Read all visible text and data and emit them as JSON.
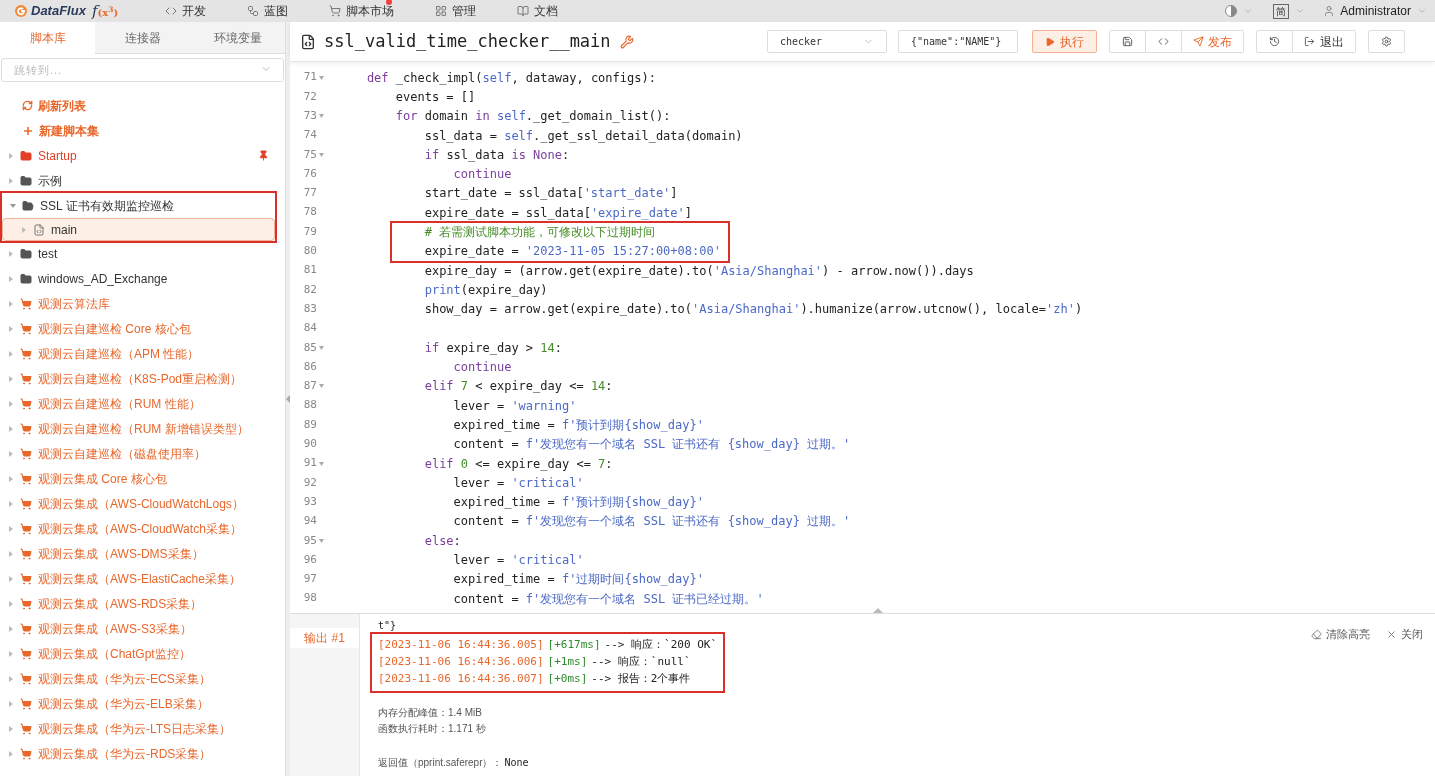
{
  "top_nav": {
    "logo": {
      "name": "DataFlux",
      "mark": "f",
      "mark_sub": "(x$^{3}$)"
    },
    "items": [
      {
        "label": "开发",
        "badge": false
      },
      {
        "label": "蓝图",
        "badge": false
      },
      {
        "label": "脚本市场",
        "badge": true
      },
      {
        "label": "管理",
        "badge": false
      },
      {
        "label": "文档",
        "badge": false
      }
    ],
    "language": "简",
    "user": "Administrator"
  },
  "sidebar": {
    "tabs": [
      {
        "label": "脚本库",
        "selected": true
      },
      {
        "label": "连接器",
        "selected": false
      },
      {
        "label": "环境变量",
        "selected": false
      }
    ],
    "search": {
      "placeholder": "跳转到..."
    },
    "actions": [
      {
        "label": "刷新列表",
        "kind": "refresh"
      },
      {
        "label": "新建脚本集",
        "kind": "add"
      }
    ],
    "tree": [
      {
        "label": "Startup",
        "kind": "pinned",
        "expanded": false,
        "marked": false
      },
      {
        "label": "示例",
        "kind": "folder",
        "expanded": false,
        "marked": false
      },
      {
        "label": "SSL 证书有效期监控巡检",
        "kind": "folder",
        "expanded": true,
        "marked": true,
        "children": [
          {
            "label": "main",
            "kind": "script",
            "selected": true
          }
        ]
      },
      {
        "label": "test",
        "kind": "folder",
        "expanded": false,
        "marked": false
      },
      {
        "label": "windows_AD_Exchange",
        "kind": "folder",
        "expanded": false,
        "marked": false
      },
      {
        "label": "观测云算法库",
        "kind": "market",
        "expanded": false,
        "marked": false
      },
      {
        "label": "观测云自建巡检 Core 核心包",
        "kind": "market",
        "expanded": false,
        "marked": false
      },
      {
        "label": "观测云自建巡检（APM 性能）",
        "kind": "market",
        "expanded": false,
        "marked": false
      },
      {
        "label": "观测云自建巡检（K8S-Pod重启检测）",
        "kind": "market",
        "expanded": false,
        "marked": false
      },
      {
        "label": "观测云自建巡检（RUM 性能）",
        "kind": "market",
        "expanded": false,
        "marked": false
      },
      {
        "label": "观测云自建巡检（RUM 新增错误类型）",
        "kind": "market",
        "expanded": false,
        "marked": false
      },
      {
        "label": "观测云自建巡检（磁盘使用率）",
        "kind": "market",
        "expanded": false,
        "marked": false
      },
      {
        "label": "观测云集成 Core 核心包",
        "kind": "market",
        "expanded": false,
        "marked": false
      },
      {
        "label": "观测云集成（AWS-CloudWatchLogs）",
        "kind": "market",
        "expanded": false,
        "marked": false
      },
      {
        "label": "观测云集成（AWS-CloudWatch采集）",
        "kind": "market",
        "expanded": false,
        "marked": false
      },
      {
        "label": "观测云集成（AWS-DMS采集）",
        "kind": "market",
        "expanded": false,
        "marked": false
      },
      {
        "label": "观测云集成（AWS-ElastiCache采集）",
        "kind": "market",
        "expanded": false,
        "marked": false
      },
      {
        "label": "观测云集成（AWS-RDS采集）",
        "kind": "market",
        "expanded": false,
        "marked": false
      },
      {
        "label": "观测云集成（AWS-S3采集）",
        "kind": "market",
        "expanded": false,
        "marked": false
      },
      {
        "label": "观测云集成（ChatGpt监控）",
        "kind": "market",
        "expanded": false,
        "marked": false
      },
      {
        "label": "观测云集成（华为云-ECS采集）",
        "kind": "market",
        "expanded": false,
        "marked": false
      },
      {
        "label": "观测云集成（华为云-ELB采集）",
        "kind": "market",
        "expanded": false,
        "marked": false
      },
      {
        "label": "观测云集成（华为云-LTS日志采集）",
        "kind": "market",
        "expanded": false,
        "marked": false
      },
      {
        "label": "观测云集成（华为云-RDS采集）",
        "kind": "market",
        "expanded": false,
        "marked": false
      }
    ]
  },
  "editor": {
    "title": "ssl_valid_time_checker__main",
    "func_select": "checker",
    "kwargs": "{\"name\":\"NAME\"}",
    "buttons": [
      {
        "label": "执行",
        "kind": "run"
      },
      {
        "kind": "save"
      },
      {
        "kind": "code"
      },
      {
        "label": "发布",
        "kind": "publish"
      },
      {
        "kind": "history"
      },
      {
        "label": "退出",
        "kind": "exit"
      },
      {
        "kind": "settings"
      }
    ],
    "lines": [
      {
        "n": "71",
        "fold": true,
        "marked": false,
        "tokens": [
          {
            "t": "    def",
            "color": "#7a3e9d"
          },
          {
            "t": " _check_impl("
          },
          {
            "t": "self",
            "color": "#4b69c6"
          },
          {
            "t": ", dataway, configs):"
          }
        ]
      },
      {
        "n": "72",
        "fold": false,
        "marked": false,
        "tokens": [
          {
            "t": "        events = []"
          }
        ]
      },
      {
        "n": "73",
        "fold": true,
        "marked": false,
        "tokens": [
          {
            "t": "        for",
            "color": "#7a3e9d"
          },
          {
            "t": " domain "
          },
          {
            "t": "in",
            "color": "#7a3e9d"
          },
          {
            "t": " self",
            "color": "#4b69c6"
          },
          {
            "t": "._get_domain_list():"
          }
        ]
      },
      {
        "n": "74",
        "fold": false,
        "marked": false,
        "tokens": [
          {
            "t": "            ssl_data = "
          },
          {
            "t": "self",
            "color": "#4b69c6"
          },
          {
            "t": "._get_ssl_detail_data(domain)"
          }
        ]
      },
      {
        "n": "75",
        "fold": true,
        "marked": false,
        "tokens": [
          {
            "t": "            if",
            "color": "#7a3e9d"
          },
          {
            "t": " ssl_data "
          },
          {
            "t": "is",
            "color": "#7a3e9d"
          },
          {
            "t": " None",
            "color": "#7a3e9d"
          },
          {
            "t": ":"
          }
        ]
      },
      {
        "n": "76",
        "fold": false,
        "marked": false,
        "tokens": [
          {
            "t": "                continue",
            "color": "#7a3e9d"
          }
        ]
      },
      {
        "n": "77",
        "fold": false,
        "marked": false,
        "tokens": [
          {
            "t": "            start_date = ssl_data["
          },
          {
            "t": "'start_date'",
            "color": "#4b69c6"
          },
          {
            "t": "]"
          }
        ]
      },
      {
        "n": "78",
        "fold": false,
        "marked": false,
        "tokens": [
          {
            "t": "            expire_date = ssl_data["
          },
          {
            "t": "'expire_date'",
            "color": "#4b69c6"
          },
          {
            "t": "]"
          }
        ]
      },
      {
        "n": "79",
        "fold": false,
        "marked": true,
        "tokens": [
          {
            "t": "            # 若需测试脚本功能，可修改以下过期时间",
            "color": "#448c27"
          }
        ]
      },
      {
        "n": "80",
        "fold": false,
        "marked": true,
        "tokens": [
          {
            "t": "            expire_date = "
          },
          {
            "t": "'2023-11-05 15:27:00+08:00'",
            "color": "#4b69c6"
          }
        ]
      },
      {
        "n": "81",
        "fold": false,
        "marked": false,
        "tokens": [
          {
            "t": "            expire_day = (arrow.get(expire_date).to("
          },
          {
            "t": "'Asia/Shanghai'",
            "color": "#4b69c6"
          },
          {
            "t": ") - arrow.now()).days"
          }
        ]
      },
      {
        "n": "82",
        "fold": false,
        "marked": false,
        "tokens": [
          {
            "t": "            print",
            "color": "#4b69c6"
          },
          {
            "t": "(expire_day)"
          }
        ]
      },
      {
        "n": "83",
        "fold": false,
        "marked": false,
        "tokens": [
          {
            "t": "            show_day = arrow.get(expire_date).to("
          },
          {
            "t": "'Asia/Shanghai'",
            "color": "#4b69c6"
          },
          {
            "t": ").humanize(arrow.utcnow(), locale="
          },
          {
            "t": "'zh'",
            "color": "#4b69c6"
          },
          {
            "t": ")"
          }
        ]
      },
      {
        "n": "84",
        "fold": false,
        "marked": false
      },
      {
        "n": "85",
        "fold": true,
        "marked": false,
        "tokens": [
          {
            "t": "            if",
            "color": "#7a3e9d"
          },
          {
            "t": " expire_day > "
          },
          {
            "t": "14",
            "color": "#448c27"
          },
          {
            "t": ":"
          }
        ]
      },
      {
        "n": "86",
        "fold": false,
        "marked": false,
        "tokens": [
          {
            "t": "                continue",
            "color": "#7a3e9d"
          }
        ]
      },
      {
        "n": "87",
        "fold": true,
        "marked": false,
        "tokens": [
          {
            "t": "            elif",
            "color": "#7a3e9d"
          },
          {
            "t": " 7",
            "color": "#448c27"
          },
          {
            "t": " < expire_day <= "
          },
          {
            "t": "14",
            "color": "#448c27"
          },
          {
            "t": ":"
          }
        ]
      },
      {
        "n": "88",
        "fold": false,
        "marked": false,
        "tokens": [
          {
            "t": "                lever = "
          },
          {
            "t": "'warning'",
            "color": "#4b69c6"
          }
        ]
      },
      {
        "n": "89",
        "fold": false,
        "marked": false,
        "tokens": [
          {
            "t": "                expired_time = "
          },
          {
            "t": "f'预计到期{show_day}'",
            "color": "#4b69c6"
          }
        ]
      },
      {
        "n": "90",
        "fold": false,
        "marked": false,
        "tokens": [
          {
            "t": "                content = "
          },
          {
            "t": "f'发现您有一个域名 SSL 证书还有 {show_day} 过期。'",
            "color": "#4b69c6"
          }
        ]
      },
      {
        "n": "91",
        "fold": true,
        "marked": false,
        "tokens": [
          {
            "t": "            elif",
            "color": "#7a3e9d"
          },
          {
            "t": " 0",
            "color": "#448c27"
          },
          {
            "t": " <= expire_day <= "
          },
          {
            "t": "7",
            "color": "#448c27"
          },
          {
            "t": ":"
          }
        ]
      },
      {
        "n": "92",
        "fold": false,
        "marked": false,
        "tokens": [
          {
            "t": "                lever = "
          },
          {
            "t": "'critical'",
            "color": "#4b69c6"
          }
        ]
      },
      {
        "n": "93",
        "fold": false,
        "marked": false,
        "tokens": [
          {
            "t": "                expired_time = "
          },
          {
            "t": "f'预计到期{show_day}'",
            "color": "#4b69c6"
          }
        ]
      },
      {
        "n": "94",
        "fold": false,
        "marked": false,
        "tokens": [
          {
            "t": "                content = "
          },
          {
            "t": "f'发现您有一个域名 SSL 证书还有 {show_day} 过期。'",
            "color": "#4b69c6"
          }
        ]
      },
      {
        "n": "95",
        "fold": true,
        "marked": false,
        "tokens": [
          {
            "t": "            else",
            "color": "#7a3e9d"
          },
          {
            "t": ":"
          }
        ]
      },
      {
        "n": "96",
        "fold": false,
        "marked": false,
        "tokens": [
          {
            "t": "                lever = "
          },
          {
            "t": "'critical'",
            "color": "#4b69c6"
          }
        ]
      },
      {
        "n": "97",
        "fold": false,
        "marked": false,
        "tokens": [
          {
            "t": "                expired_time = "
          },
          {
            "t": "f'过期时间{show_day}'",
            "color": "#4b69c6"
          }
        ]
      },
      {
        "n": "98",
        "fold": false,
        "marked": false,
        "tokens": [
          {
            "t": "                content = "
          },
          {
            "t": "f'发现您有一个域名 SSL 证书已经过期。'",
            "color": "#4b69c6"
          }
        ]
      }
    ]
  },
  "output": {
    "tabs": [
      {
        "label": "输出 #1",
        "selected": true
      }
    ],
    "actions": [
      {
        "label": "清除高亮",
        "kind": "clear"
      },
      {
        "label": "关闭",
        "kind": "close"
      }
    ],
    "lead": "t\"}",
    "log_marked": true,
    "log": [
      {
        "time": "[2023-11-06 16:44:36.005]",
        "delta": "[+617ms]",
        "message": "--> 响应：`200 OK`"
      },
      {
        "time": "[2023-11-06 16:44:36.006]",
        "delta": "[+1ms]",
        "message": "--> 响应：`null`"
      },
      {
        "time": "[2023-11-06 16:44:36.007]",
        "delta": "[+0ms]",
        "message": "--> 报告：2个事件"
      }
    ],
    "stats": [
      "内存分配峰值：1.4 MiB",
      "函数执行耗时：1.171 秒"
    ],
    "return_label": "返回值（pprint.saferepr）：",
    "return_value": "None"
  }
}
